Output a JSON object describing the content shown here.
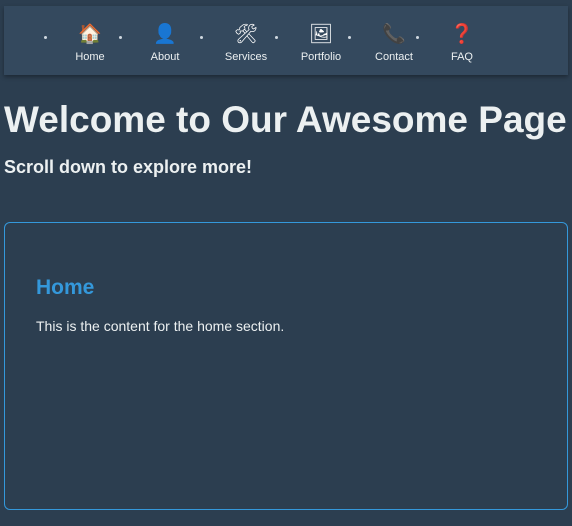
{
  "nav": {
    "items": [
      {
        "icon": "house-icon",
        "glyph": "🏠",
        "label": "Home"
      },
      {
        "icon": "person-icon",
        "glyph": "👤",
        "label": "About"
      },
      {
        "icon": "hammer-and-wrench-icon",
        "glyph": "🛠",
        "label": "Services"
      },
      {
        "icon": "framed-picture-icon",
        "glyph": "🖼",
        "label": "Portfolio"
      },
      {
        "icon": "telephone-icon",
        "glyph": "📞",
        "label": "Contact"
      },
      {
        "icon": "question-mark-icon",
        "glyph": "❓",
        "label": "FAQ"
      }
    ]
  },
  "header": {
    "title": "Welcome to Our Awesome Page",
    "subtitle": "Scroll down to explore more!"
  },
  "section": {
    "heading": "Home",
    "text": "This is the content for the home section."
  },
  "colors": {
    "background": "#2c3e50",
    "navbar": "#34495e",
    "accent": "#3498db",
    "text": "#ecf0f1"
  }
}
